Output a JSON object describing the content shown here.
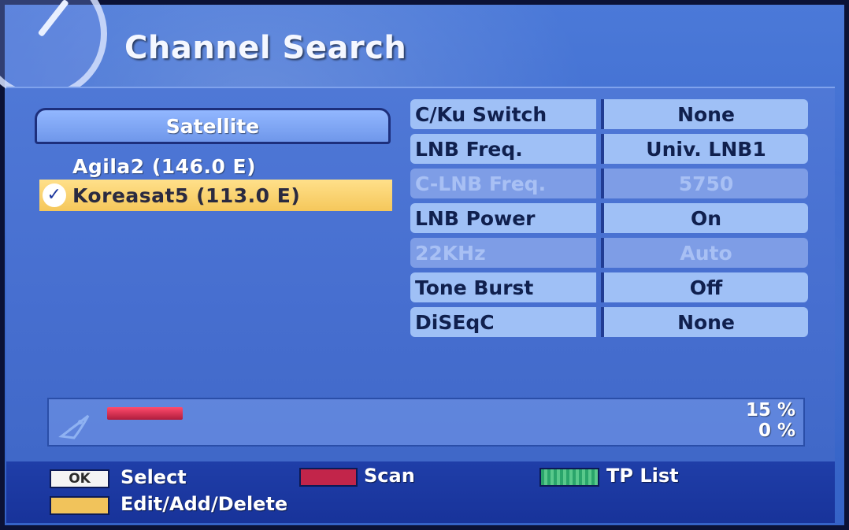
{
  "header": {
    "title": "Channel Search"
  },
  "satellites": {
    "header": "Satellite",
    "items": [
      {
        "label": "Agila2 (146.0 E)",
        "selected": false
      },
      {
        "label": "Koreasat5 (113.0 E)",
        "selected": true
      }
    ],
    "check_glyph": "✓"
  },
  "settings": [
    {
      "label": "C/Ku Switch",
      "value": "None",
      "enabled": true
    },
    {
      "label": "LNB Freq.",
      "value": "Univ. LNB1",
      "enabled": true
    },
    {
      "label": "C-LNB Freq.",
      "value": "5750",
      "enabled": false
    },
    {
      "label": "LNB Power",
      "value": "On",
      "enabled": true
    },
    {
      "label": "22KHz",
      "value": "Auto",
      "enabled": false
    },
    {
      "label": "Tone Burst",
      "value": "Off",
      "enabled": true
    },
    {
      "label": "DiSEqC",
      "value": "None",
      "enabled": true
    }
  ],
  "progress": {
    "signal_percent_label": "15 %",
    "quality_percent_label": "0 %",
    "signal_fraction": 0.15,
    "icon": "satellite-dish-icon"
  },
  "footer": {
    "ok_key_label": "OK",
    "select_label": "Select",
    "scan_label": "Scan",
    "tp_list_label": "TP List",
    "edit_label": "Edit/Add/Delete",
    "colors": {
      "red": "#c2254a",
      "green": "#2aa56b",
      "yellow": "#f1c35b"
    }
  }
}
